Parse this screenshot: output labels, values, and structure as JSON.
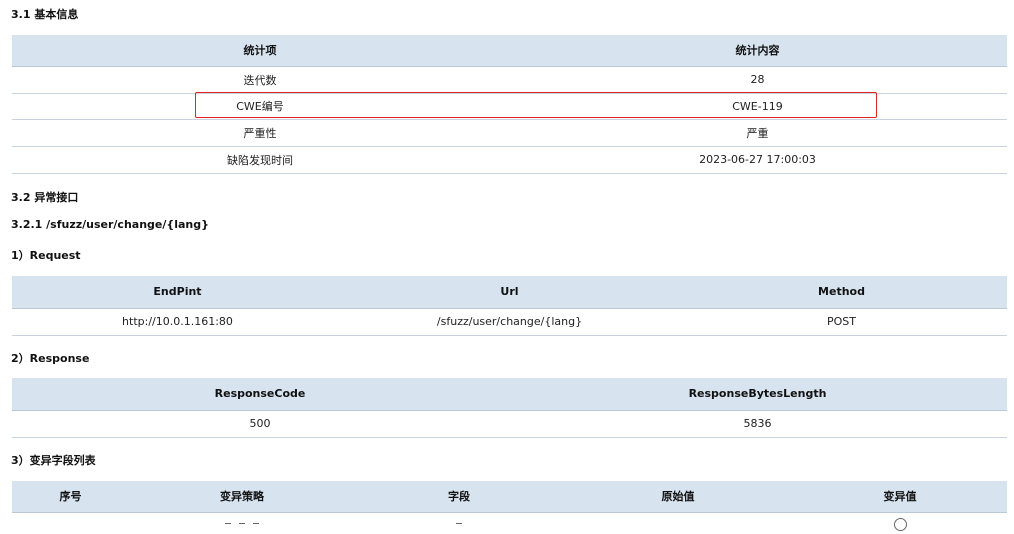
{
  "section_basic": {
    "heading": "3.1 基本信息",
    "headers": [
      "统计项",
      "统计内容"
    ],
    "rows": [
      {
        "item": "迭代数",
        "value": "28"
      },
      {
        "item": "CWE编号",
        "value": "CWE-119"
      },
      {
        "item": "严重性",
        "value": "严重"
      },
      {
        "item": "缺陷发现时间",
        "value": "2023-06-27 17:00:03"
      }
    ]
  },
  "section_abnormal": {
    "heading": "3.2 异常接口",
    "endpoint_heading": "3.2.1 /sfuzz/user/change/{lang}",
    "request": {
      "heading": "1）Request",
      "headers": [
        "EndPint",
        "Url",
        "Method"
      ],
      "row": [
        "http://10.0.1.161:80",
        "/sfuzz/user/change/{lang}",
        "POST"
      ]
    },
    "response": {
      "heading": "2）Response",
      "headers": [
        "ResponseCode",
        "ResponseBytesLength"
      ],
      "row": [
        "500",
        "5836"
      ]
    },
    "mutation": {
      "heading": "3）变异字段列表",
      "headers": [
        "序号",
        "变异策略",
        "字段",
        "原始值",
        "变异值"
      ]
    }
  }
}
